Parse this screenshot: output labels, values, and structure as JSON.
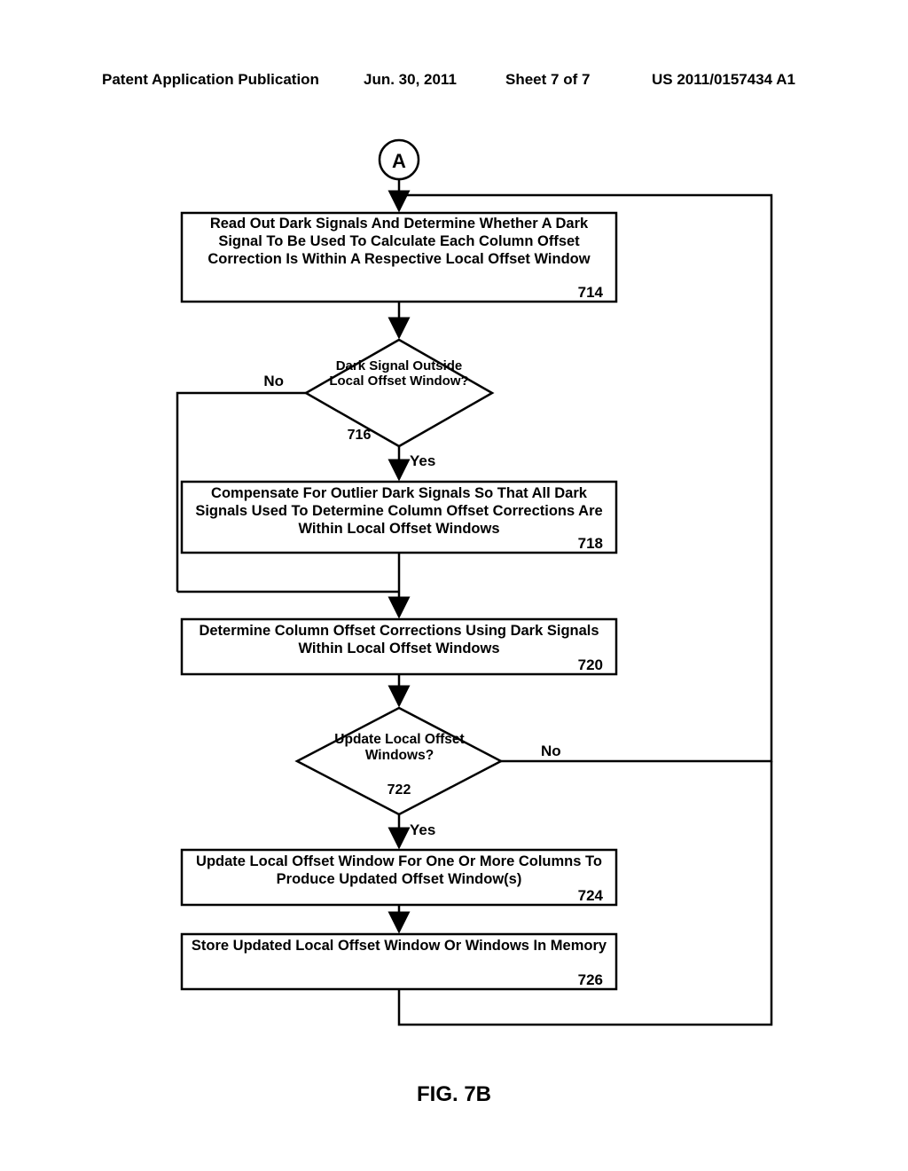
{
  "header": {
    "left": "Patent Application Publication",
    "date": "Jun. 30, 2011",
    "sheet": "Sheet 7 of 7",
    "pubno": "US 2011/0157434 A1"
  },
  "figure_label": "FIG. 7B",
  "connector": {
    "label": "A"
  },
  "boxes": {
    "714": {
      "text": "Read Out Dark Signals And Determine Whether A Dark Signal To Be Used To Calculate Each Column Offset Correction Is Within A Respective Local Offset Window",
      "num": "714"
    },
    "718": {
      "text": "Compensate For Outlier Dark Signals So That All Dark Signals Used To Determine Column Offset Corrections Are Within Local Offset Windows",
      "num": "718"
    },
    "720": {
      "text": "Determine Column Offset Corrections Using Dark Signals Within Local Offset Windows",
      "num": "720"
    },
    "724": {
      "text": "Update Local Offset Window For One Or More Columns To Produce Updated Offset Window(s)",
      "num": "724"
    },
    "726": {
      "text": "Store Updated Local Offset Window Or Windows In Memory",
      "num": "726"
    }
  },
  "decisions": {
    "716": {
      "text": "Dark Signal Outside Local Offset Window?",
      "num": "716",
      "no": "No",
      "yes": "Yes"
    },
    "722": {
      "text": "Update Local Offset Windows?",
      "num": "722",
      "no": "No",
      "yes": "Yes"
    }
  }
}
